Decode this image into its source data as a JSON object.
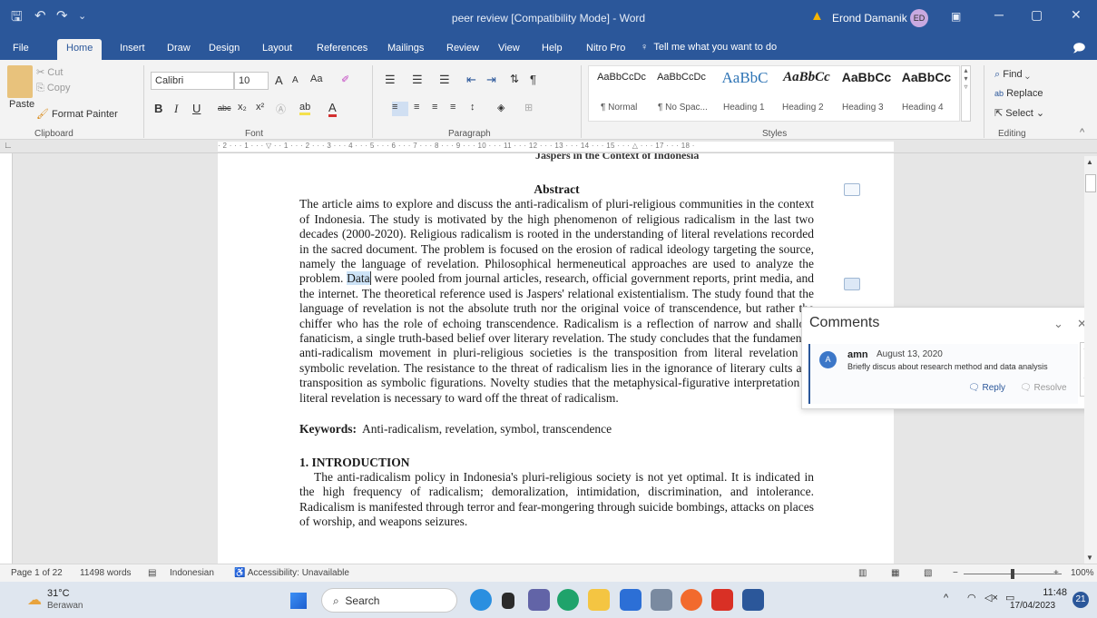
{
  "window": {
    "title": "peer review [Compatibility Mode]  -  Word",
    "user": "Erond Damanik",
    "user_initials": "ED",
    "min": "─",
    "restore": "▢",
    "close": "✕"
  },
  "quick_access": {
    "save": "🖫",
    "undo": "↶",
    "redo": "↷",
    "more": "⌄"
  },
  "menu": {
    "items": [
      "File",
      "Home",
      "Insert",
      "Draw",
      "Design",
      "Layout",
      "References",
      "Mailings",
      "Review",
      "View",
      "Help",
      "Nitro Pro"
    ],
    "tell_me": "Tell me what you want to do",
    "comment_ico": "🗩"
  },
  "ribbon": {
    "clipboard": {
      "paste": "Paste",
      "cut": "Cut",
      "copy": "Copy",
      "format_painter": "Format Painter",
      "label": "Clipboard"
    },
    "font": {
      "name": "Calibri",
      "size": "10",
      "grow": "A",
      "shrink": "A",
      "case": "Aa",
      "bold": "B",
      "italic": "I",
      "underline": "U",
      "strike": "abc",
      "sub": "x₂",
      "sup": "x²",
      "label": "Font"
    },
    "paragraph": {
      "label": "Paragraph",
      "show": "¶"
    },
    "styles": {
      "label": "Styles",
      "items": [
        {
          "preview": "AaBbCcDc",
          "name": "¶ Normal"
        },
        {
          "preview": "AaBbCcDc",
          "name": "¶ No Spac..."
        },
        {
          "preview": "AaBbC",
          "name": "Heading 1"
        },
        {
          "preview": "AaBbCc",
          "name": "Heading 2"
        },
        {
          "preview": "AaBbCc",
          "name": "Heading 3"
        },
        {
          "preview": "AaBbCc",
          "name": "Heading 4"
        }
      ]
    },
    "editing": {
      "find": "Find",
      "replace": "Replace",
      "select": "Select",
      "label": "Editing"
    }
  },
  "ruler": "· 2 · · · 1 · · · ▽ · · 1 · · · 2 · · · 3 · · · 4 · · · 5 · · · 6 · · · 7 · · · 8 · · · 9 · · · 10 · · · 11 · · · 12 · · · 13 · · · 14 · · · 15 · · · △ · · · 17 · · · 18 ·",
  "document": {
    "cut_heading": "Jaspers in the Context of Indonesia",
    "abstract_title": "Abstract",
    "abstract_before": "The article aims to explore and discuss the anti-radicalism of pluri-religious communities in the context of Indonesia. The study is motivated by the high phenomenon of religious radicalism in the last two decades (2000-2020). Religious radicalism is rooted in the understanding of literal revelations recorded in the sacred document. The problem is focused on the erosion of radical ideology targeting the source, namely the language of revelation. Philosophical hermeneutical approaches are used to analyze the problem. ",
    "abstract_highlight": "Data",
    "abstract_after": " were pooled from journal articles, research, official government reports, print media, and the internet. The theoretical reference used is Jaspers' relational existentialism. The study found that the language of revelation is not the absolute truth nor the original voice of transcendence, but rather the chiffer who has the role of echoing transcendence. Radicalism is a reflection of narrow and shallow fanaticism, a single truth-based belief over literary revelation. The study concludes that the fundamental anti-radicalism movement in pluri-religious societies is the transposition from literal revelation to symbolic revelation. The resistance to the threat of radicalism lies in the ignorance of literary cults and transposition as symbolic figurations. Novelty studies that the metaphysical-figurative interpretation of literal revelation is necessary to ward off the threat of radicalism.",
    "keywords_label": "Keywords:",
    "keywords": "Anti-radicalism, revelation, symbol, transcendence",
    "intro_title": "1. INTRODUCTION",
    "intro_body": "The anti-radicalism policy in Indonesia's pluri-religious society is not yet optimal. It is indicated in the high frequency of radicalism; demoralization, intimidation, discrimination, and intolerance. Radicalism is manifested through terror and fear-mongering through suicide bombings, attacks on places of worship, and weapons seizures."
  },
  "comments": {
    "title": "Comments",
    "author": "amn",
    "date": "August 13, 2020",
    "text": "Briefly discus about research method and data analysis",
    "reply": "Reply",
    "resolve": "Resolve",
    "initial": "A"
  },
  "status": {
    "page": "Page 1 of 22",
    "words": "11498 words",
    "language": "Indonesian",
    "accessibility": "Accessibility: Unavailable",
    "zoom": "100%"
  },
  "taskbar": {
    "temp": "31°C",
    "weather": "Berawan",
    "search": "Search",
    "time": "11:48",
    "date": "17/04/2023",
    "notif": "21"
  }
}
